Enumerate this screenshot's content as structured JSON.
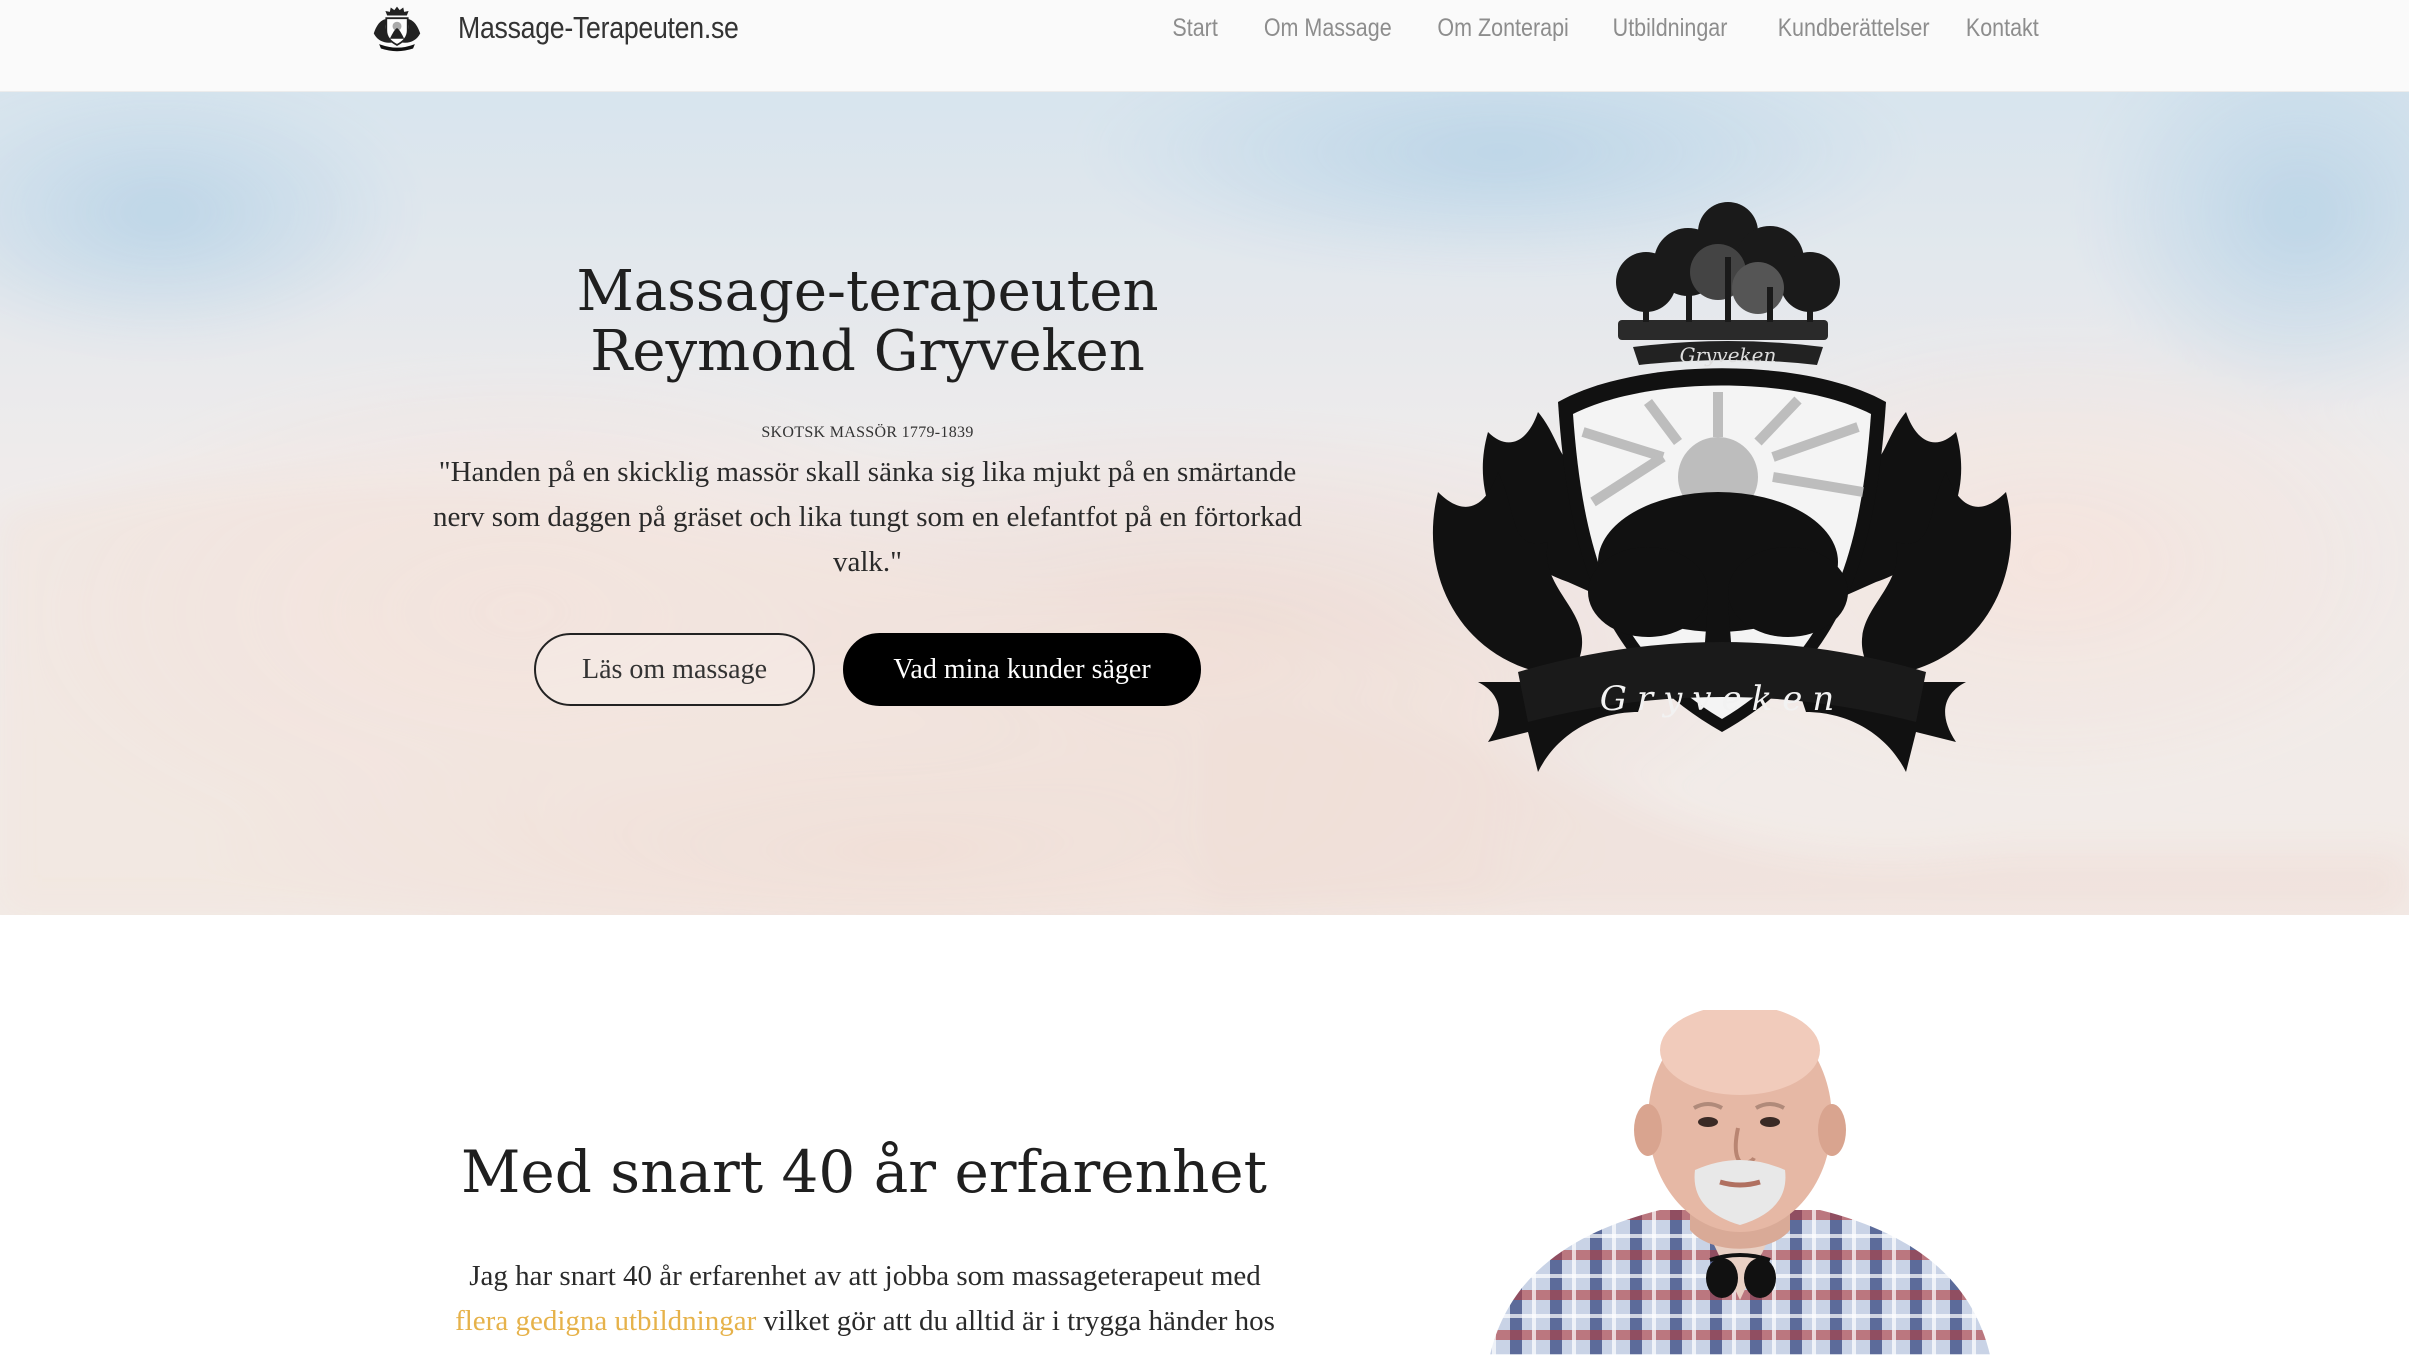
{
  "navbar": {
    "brand_name": "Massage-Terapeuten.se",
    "logo_icon": "gryveken-crest-icon",
    "links": [
      "Start",
      "Om Massage",
      "Om Zonterapi",
      "Utbildningar",
      "Kundberättelser",
      "Kontakt"
    ]
  },
  "hero": {
    "title_line1": "Massage-terapeuten",
    "title_line2": "Reymond Gryveken",
    "quote_source": "Skotsk massör 1779-1839",
    "quote": "\"Handen på en skicklig massör skall sänka sig lika mjukt på en smärtande nerv som daggen på gräset och lika tungt som en elefantfot på en förtorkad valk.\"",
    "button_primary": "Läs om massage",
    "button_secondary": "Vad mina kunder säger",
    "crest_banner_top": "Gryveken",
    "crest_banner_bottom": "Gryveken"
  },
  "about": {
    "title": "Med snart 40 år erfarenhet",
    "text_before_link": "Jag har snart 40 år erfarenhet av att jobba som massageterapeut med ",
    "link_text": "flera gedigna utbildningar",
    "text_after_link": " vilket gör att du alltid är i trygga händer hos"
  },
  "colors": {
    "link_accent": "#e6b24a",
    "button_dark": "#000000",
    "nav_text": "#8d8d8d"
  }
}
